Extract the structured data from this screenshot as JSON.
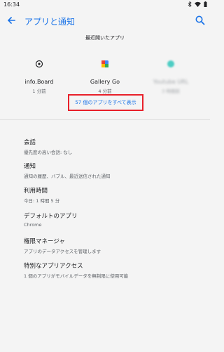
{
  "status_bar": {
    "time": "16:34"
  },
  "app_bar": {
    "title": "アプリと通知"
  },
  "recent": {
    "header": "最近開いたアプリ",
    "apps": [
      {
        "name": "info.Board",
        "time": "1 分前",
        "icon": "app-icon-infoboard",
        "icon_color": "#202124"
      },
      {
        "name": "Gallery Go",
        "time": "4 分前",
        "icon": "app-icon-gallery-go",
        "icon_color": "#4285f4"
      },
      {
        "name": "Youtube URL",
        "time": "3 時間前",
        "icon": "app-icon-redacted",
        "icon_color": "#4ecdc4"
      }
    ],
    "see_all": "57 個のアプリをすべて表示"
  },
  "settings": [
    {
      "title": "会話",
      "subtitle": "優先度の高い会話: なし"
    },
    {
      "title": "通知",
      "subtitle": "通知の履歴、バブル、最近送信された通知"
    },
    {
      "title": "利用時間",
      "subtitle": "今日: 1 時間 5 分"
    },
    {
      "title": "デフォルトのアプリ",
      "subtitle": "Chrome"
    },
    {
      "title": "権限マネージャ",
      "subtitle": "アプリのデータアクセスを管理します"
    },
    {
      "title": "特別なアプリアクセス",
      "subtitle": "1 個のアプリがモバイルデータを無制限に使用可能"
    }
  ],
  "colors": {
    "accent": "#1a73e8",
    "highlight_box": "#e8202a",
    "background": "#f4f4f4"
  }
}
